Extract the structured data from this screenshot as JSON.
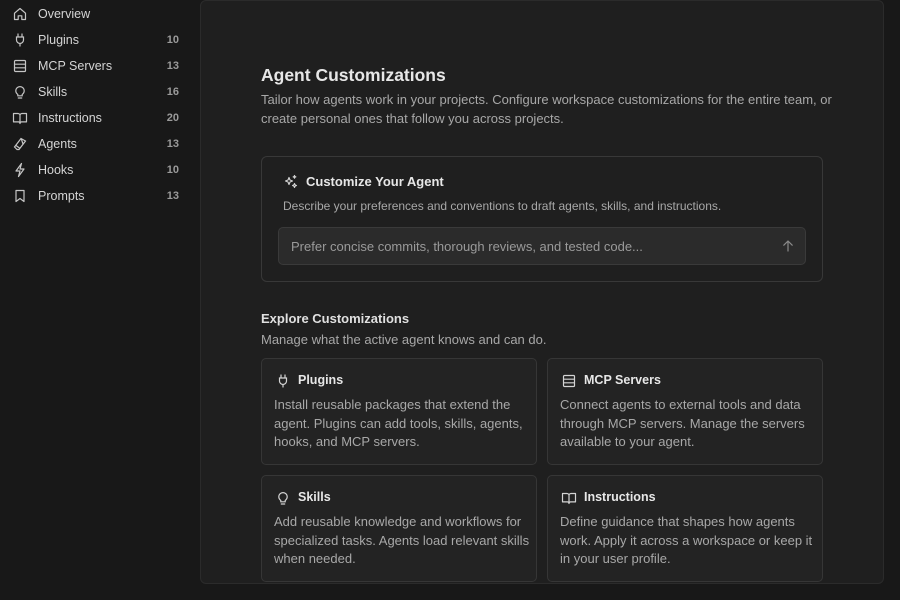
{
  "sidebar": {
    "items": [
      {
        "label": "Overview",
        "count": "",
        "icon": "home-icon"
      },
      {
        "label": "Plugins",
        "count": "10",
        "icon": "plug-icon"
      },
      {
        "label": "MCP Servers",
        "count": "13",
        "icon": "server-icon"
      },
      {
        "label": "Skills",
        "count": "16",
        "icon": "lightbulb-icon"
      },
      {
        "label": "Instructions",
        "count": "20",
        "icon": "book-icon"
      },
      {
        "label": "Agents",
        "count": "13",
        "icon": "agent-icon"
      },
      {
        "label": "Hooks",
        "count": "10",
        "icon": "lightning-icon"
      },
      {
        "label": "Prompts",
        "count": "13",
        "icon": "bookmark-icon"
      }
    ]
  },
  "main": {
    "title": "Agent Customizations",
    "description": "Tailor how agents work in your projects. Configure workspace customizations for the entire team, or create personal ones that follow you across projects.",
    "customize": {
      "title": "Customize Your Agent",
      "description": "Describe your preferences and conventions to draft agents, skills, and instructions.",
      "placeholder": "Prefer concise commits, thorough reviews, and tested code...",
      "value": ""
    },
    "explore": {
      "title": "Explore Customizations",
      "description": "Manage what the active agent knows and can do.",
      "cards": [
        {
          "title": "Plugins",
          "icon": "plug-icon",
          "description": "Install reusable packages that extend the agent. Plugins can add tools, skills, agents, hooks, and MCP servers."
        },
        {
          "title": "MCP Servers",
          "icon": "server-icon",
          "description": "Connect agents to external tools and data through MCP servers. Manage the servers available to your agent."
        },
        {
          "title": "Skills",
          "icon": "lightbulb-icon",
          "description": "Add reusable knowledge and workflows for specialized tasks. Agents load relevant skills when needed."
        },
        {
          "title": "Instructions",
          "icon": "book-icon",
          "description": "Define guidance that shapes how agents work. Apply it across a workspace or keep it in your user profile."
        }
      ]
    }
  },
  "colors": {
    "background": "#181818",
    "panel": "#1f1f1f",
    "card": "#232323",
    "text": "#cccccc",
    "muted": "#a8a8a8"
  }
}
